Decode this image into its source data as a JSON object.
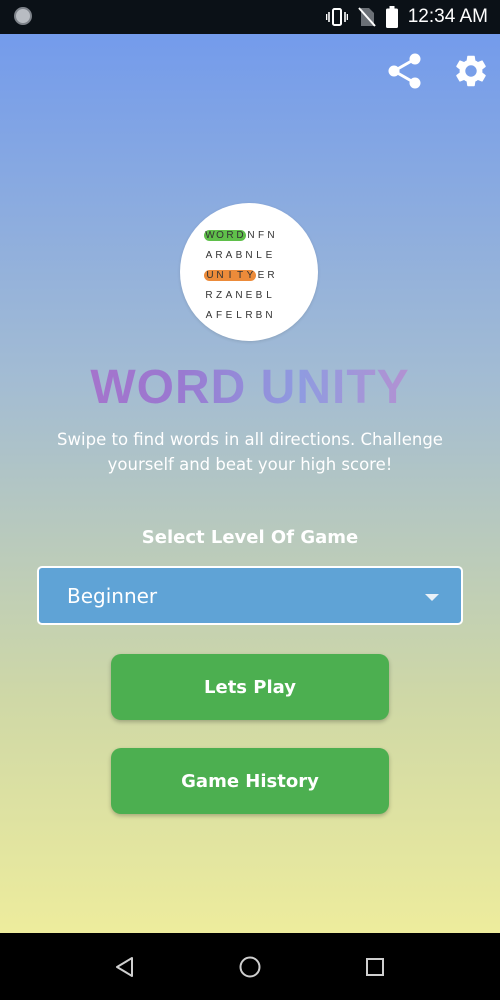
{
  "status_bar": {
    "time": "12:34 AM"
  },
  "top_actions": {
    "share_icon": "share-icon",
    "settings_icon": "gear-icon"
  },
  "logo": {
    "rows": [
      {
        "highlight": "WORD",
        "rest": "NFN",
        "color": "#5fbf4a"
      },
      {
        "highlight": "",
        "rest": "ARABNLE",
        "color": ""
      },
      {
        "highlight": "UNITY",
        "rest": "ER",
        "color": "#ec8b3a"
      },
      {
        "highlight": "",
        "rest": "RZANEBL",
        "color": ""
      },
      {
        "highlight": "",
        "rest": "AFELRBN",
        "color": ""
      }
    ]
  },
  "title": "WORD UNITY",
  "subtitle": "Swipe to find words in all directions. Challenge yourself and beat your high score!",
  "level": {
    "label": "Select Level Of Game",
    "selected": "Beginner"
  },
  "buttons": {
    "play": "Lets Play",
    "history": "Game History"
  },
  "colors": {
    "button_green": "#4caf50",
    "select_blue": "#5fa3d6",
    "highlight_green": "#5fbf4a",
    "highlight_orange": "#ec8b3a"
  }
}
